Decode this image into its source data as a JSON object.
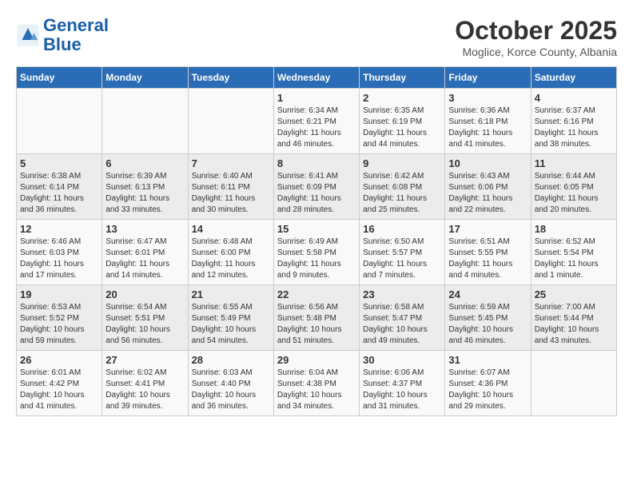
{
  "header": {
    "logo_line1": "General",
    "logo_line2": "Blue",
    "month": "October 2025",
    "location": "Moglice, Korce County, Albania"
  },
  "days_of_week": [
    "Sunday",
    "Monday",
    "Tuesday",
    "Wednesday",
    "Thursday",
    "Friday",
    "Saturday"
  ],
  "weeks": [
    [
      {
        "num": "",
        "info": ""
      },
      {
        "num": "",
        "info": ""
      },
      {
        "num": "",
        "info": ""
      },
      {
        "num": "1",
        "info": "Sunrise: 6:34 AM\nSunset: 6:21 PM\nDaylight: 11 hours and 46 minutes."
      },
      {
        "num": "2",
        "info": "Sunrise: 6:35 AM\nSunset: 6:19 PM\nDaylight: 11 hours and 44 minutes."
      },
      {
        "num": "3",
        "info": "Sunrise: 6:36 AM\nSunset: 6:18 PM\nDaylight: 11 hours and 41 minutes."
      },
      {
        "num": "4",
        "info": "Sunrise: 6:37 AM\nSunset: 6:16 PM\nDaylight: 11 hours and 38 minutes."
      }
    ],
    [
      {
        "num": "5",
        "info": "Sunrise: 6:38 AM\nSunset: 6:14 PM\nDaylight: 11 hours and 36 minutes."
      },
      {
        "num": "6",
        "info": "Sunrise: 6:39 AM\nSunset: 6:13 PM\nDaylight: 11 hours and 33 minutes."
      },
      {
        "num": "7",
        "info": "Sunrise: 6:40 AM\nSunset: 6:11 PM\nDaylight: 11 hours and 30 minutes."
      },
      {
        "num": "8",
        "info": "Sunrise: 6:41 AM\nSunset: 6:09 PM\nDaylight: 11 hours and 28 minutes."
      },
      {
        "num": "9",
        "info": "Sunrise: 6:42 AM\nSunset: 6:08 PM\nDaylight: 11 hours and 25 minutes."
      },
      {
        "num": "10",
        "info": "Sunrise: 6:43 AM\nSunset: 6:06 PM\nDaylight: 11 hours and 22 minutes."
      },
      {
        "num": "11",
        "info": "Sunrise: 6:44 AM\nSunset: 6:05 PM\nDaylight: 11 hours and 20 minutes."
      }
    ],
    [
      {
        "num": "12",
        "info": "Sunrise: 6:46 AM\nSunset: 6:03 PM\nDaylight: 11 hours and 17 minutes."
      },
      {
        "num": "13",
        "info": "Sunrise: 6:47 AM\nSunset: 6:01 PM\nDaylight: 11 hours and 14 minutes."
      },
      {
        "num": "14",
        "info": "Sunrise: 6:48 AM\nSunset: 6:00 PM\nDaylight: 11 hours and 12 minutes."
      },
      {
        "num": "15",
        "info": "Sunrise: 6:49 AM\nSunset: 5:58 PM\nDaylight: 11 hours and 9 minutes."
      },
      {
        "num": "16",
        "info": "Sunrise: 6:50 AM\nSunset: 5:57 PM\nDaylight: 11 hours and 7 minutes."
      },
      {
        "num": "17",
        "info": "Sunrise: 6:51 AM\nSunset: 5:55 PM\nDaylight: 11 hours and 4 minutes."
      },
      {
        "num": "18",
        "info": "Sunrise: 6:52 AM\nSunset: 5:54 PM\nDaylight: 11 hours and 1 minute."
      }
    ],
    [
      {
        "num": "19",
        "info": "Sunrise: 6:53 AM\nSunset: 5:52 PM\nDaylight: 10 hours and 59 minutes."
      },
      {
        "num": "20",
        "info": "Sunrise: 6:54 AM\nSunset: 5:51 PM\nDaylight: 10 hours and 56 minutes."
      },
      {
        "num": "21",
        "info": "Sunrise: 6:55 AM\nSunset: 5:49 PM\nDaylight: 10 hours and 54 minutes."
      },
      {
        "num": "22",
        "info": "Sunrise: 6:56 AM\nSunset: 5:48 PM\nDaylight: 10 hours and 51 minutes."
      },
      {
        "num": "23",
        "info": "Sunrise: 6:58 AM\nSunset: 5:47 PM\nDaylight: 10 hours and 49 minutes."
      },
      {
        "num": "24",
        "info": "Sunrise: 6:59 AM\nSunset: 5:45 PM\nDaylight: 10 hours and 46 minutes."
      },
      {
        "num": "25",
        "info": "Sunrise: 7:00 AM\nSunset: 5:44 PM\nDaylight: 10 hours and 43 minutes."
      }
    ],
    [
      {
        "num": "26",
        "info": "Sunrise: 6:01 AM\nSunset: 4:42 PM\nDaylight: 10 hours and 41 minutes."
      },
      {
        "num": "27",
        "info": "Sunrise: 6:02 AM\nSunset: 4:41 PM\nDaylight: 10 hours and 39 minutes."
      },
      {
        "num": "28",
        "info": "Sunrise: 6:03 AM\nSunset: 4:40 PM\nDaylight: 10 hours and 36 minutes."
      },
      {
        "num": "29",
        "info": "Sunrise: 6:04 AM\nSunset: 4:38 PM\nDaylight: 10 hours and 34 minutes."
      },
      {
        "num": "30",
        "info": "Sunrise: 6:06 AM\nSunset: 4:37 PM\nDaylight: 10 hours and 31 minutes."
      },
      {
        "num": "31",
        "info": "Sunrise: 6:07 AM\nSunset: 4:36 PM\nDaylight: 10 hours and 29 minutes."
      },
      {
        "num": "",
        "info": ""
      }
    ]
  ]
}
